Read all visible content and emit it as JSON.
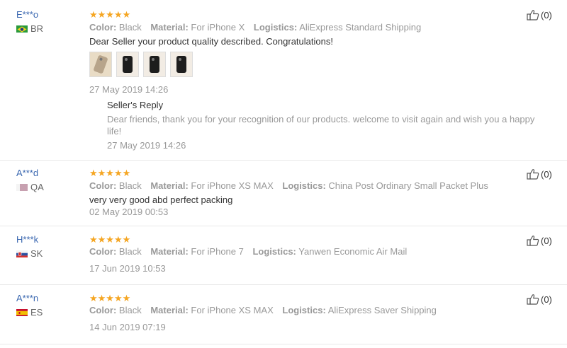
{
  "labels": {
    "color": "Color:",
    "material": "Material:",
    "logistics": "Logistics:"
  },
  "stars": "★★★★★",
  "colors": {
    "star": "#f5a623",
    "username": "#3a67b0",
    "muted": "#999999"
  },
  "reviews": [
    {
      "user": "E***o",
      "country": "BR",
      "color": "Black",
      "material": "For iPhone X",
      "logistics": "AliExpress Standard Shipping",
      "text": "Dear Seller your product quality described. Congratulations!",
      "date": "27 May 2019 14:26",
      "likes": "(0)",
      "photos": 4,
      "reply": {
        "title": "Seller's Reply",
        "text": "Dear friends, thank you for your recognition of our products. welcome to visit again and wish you a happy life!",
        "date": "27 May 2019 14:26"
      }
    },
    {
      "user": "A***d",
      "country": "QA",
      "color": "Black",
      "material": "For iPhone XS MAX",
      "logistics": "China Post Ordinary Small Packet Plus",
      "text": "very very good abd perfect packing",
      "date": "02 May 2019 00:53",
      "likes": "(0)"
    },
    {
      "user": "H***k",
      "country": "SK",
      "color": "Black",
      "material": "For iPhone 7",
      "logistics": "Yanwen Economic Air Mail",
      "date": "17 Jun 2019 10:53",
      "likes": "(0)"
    },
    {
      "user": "A***n",
      "country": "ES",
      "color": "Black",
      "material": "For iPhone XS MAX",
      "logistics": "AliExpress Saver Shipping",
      "date": "14 Jun 2019 07:19",
      "likes": "(0)"
    }
  ]
}
